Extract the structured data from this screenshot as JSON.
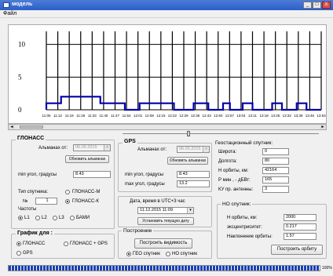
{
  "window": {
    "title": "модель",
    "min": "_",
    "max": "□",
    "close": "X"
  },
  "menu": {
    "file": "Файл"
  },
  "chart_data": {
    "type": "line",
    "y_ticks": [
      "10",
      "5",
      "0"
    ],
    "ylim": [
      0,
      12
    ],
    "xlim": [
      0,
      28
    ],
    "x_ticks": [
      "11:05",
      "11:12",
      "11:19",
      "11:26",
      "11:33",
      "11:40",
      "11:47",
      "11:54",
      "12:01",
      "12:08",
      "12:15",
      "12:22",
      "12:29",
      "12:36",
      "12:43",
      "12:50",
      "12:57",
      "13:04",
      "13:11",
      "13:18",
      "13:25",
      "13:32",
      "13:39",
      "13:46",
      "13:53"
    ],
    "series": [
      {
        "color": "#0000aa",
        "x": [
          0,
          0,
          1.5,
          1.5,
          5.5,
          5.5,
          8,
          8,
          9.5,
          9.5,
          13,
          13,
          15,
          15,
          16.5,
          16.5,
          18,
          18,
          18.7,
          18.7,
          20,
          20,
          21,
          21,
          23,
          23,
          24,
          24,
          25.5,
          25.5,
          26.5,
          26.5,
          28
        ],
        "y": [
          0,
          1,
          1,
          2,
          2,
          1,
          1,
          0,
          0,
          1,
          1,
          0,
          0,
          1,
          1,
          0,
          0,
          1,
          1,
          0,
          0,
          1,
          1,
          0,
          0,
          1,
          1,
          0,
          0,
          1,
          1,
          0,
          0
        ]
      }
    ]
  },
  "glonass": {
    "title": "ГЛОНАСС",
    "almanac_label": "Альманах от:",
    "almanac_date": "06.05.2015",
    "update_button": "Обновить альманах",
    "min_angle_label": "min угол, градусы",
    "min_angle_value": "8.43",
    "sat_type_label": "Тип спутника:",
    "opt_m": "ГЛОНАСС-М",
    "opt_k": "ГЛОНАСС-К",
    "num_label": "№",
    "num_value": "1",
    "freq_label": "Частоты",
    "freqs": [
      "L1",
      "L2",
      "L3",
      "БАМИ"
    ]
  },
  "graph_for": {
    "title": "График для :",
    "opt_glonass": "ГЛОНАСС",
    "opt_both": "ГЛОНАСС + GPS",
    "opt_gps": "GPS"
  },
  "gps": {
    "title": "GPS",
    "almanac_label": "Альманах от:",
    "almanac_date": "06.05.2015",
    "update_button": "Обновить альманах",
    "min_angle_label": "min угол, градусы",
    "min_angle_value": "8.43",
    "max_angle_label": "max угол, градусы",
    "max_angle_value": "13.2"
  },
  "datetime": {
    "label": "Дата, время в UTC+3 час",
    "value": "11.12.2015 11:09",
    "set_button": "Установить текущую дату"
  },
  "build": {
    "title": "Построение",
    "visibility_button": "Построить видимость",
    "opt_geo": "ГЕО спутник",
    "opt_no": "НО спутник"
  },
  "geo": {
    "title": "Геостационный спутник:",
    "lat_label": "Широта:",
    "lat_value": "0",
    "lon_label": "Долгота:",
    "lon_value": "80",
    "orbit_label": "Н орбиты, км:",
    "orbit_value": "42164",
    "pmin_label": "Р мин , - дБВт:",
    "pmin_value": "165",
    "ku_label": "КУ пр. антенны:",
    "ku_value": "3"
  },
  "no": {
    "title": "НО спутник:",
    "orbit_label": "Н орбиты, км:",
    "orbit_value": "2000",
    "ecc_label": "эксцентриситет:",
    "ecc_value": "0.217",
    "incl_label": "Наклонение орбиты:",
    "incl_value": "1.57",
    "build_button": "Построить орбиту"
  },
  "progress": {
    "label": "100%",
    "fraction": 1.0
  }
}
